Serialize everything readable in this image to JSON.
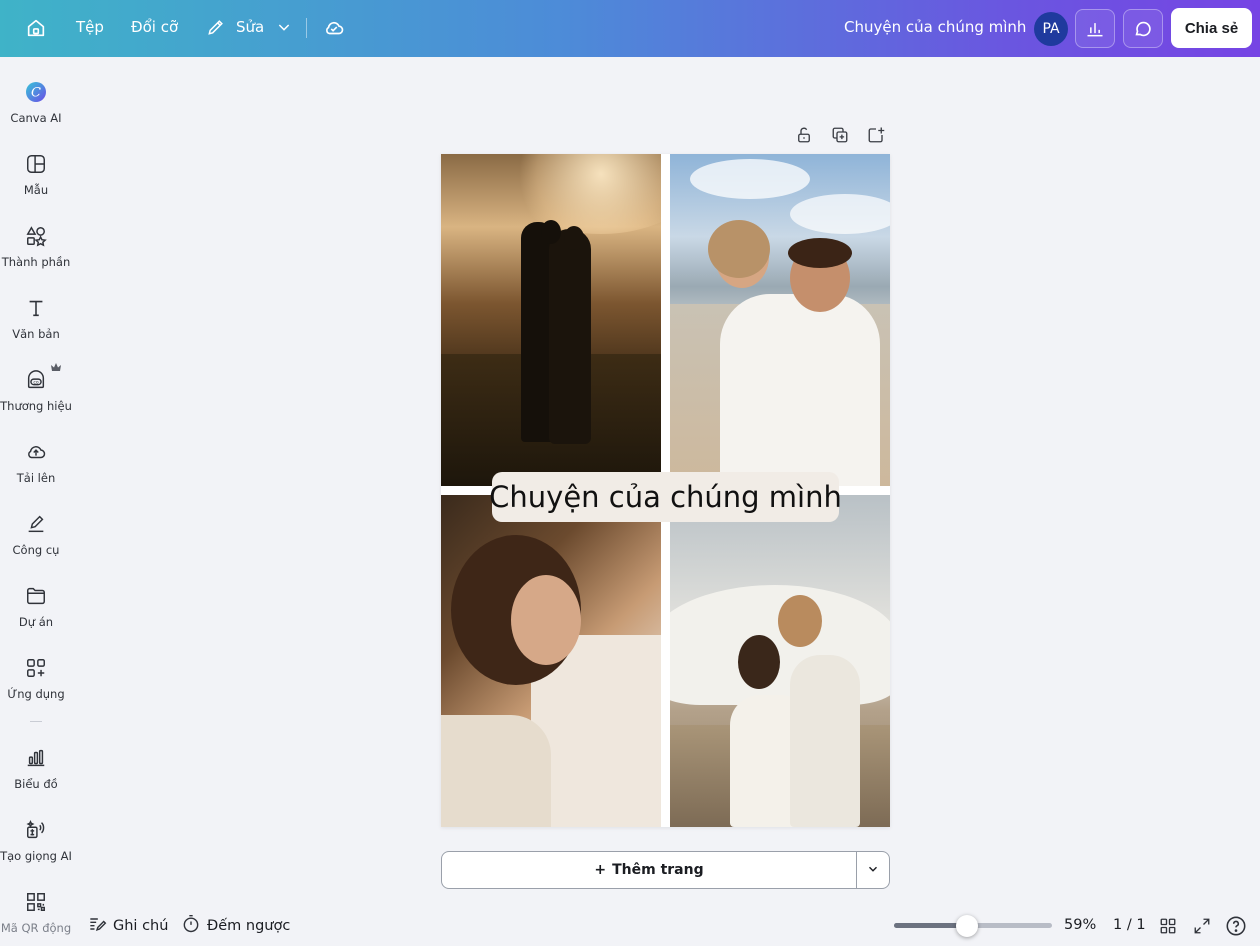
{
  "topbar": {
    "file_label": "Tệp",
    "resize_label": "Đổi cỡ",
    "edit_label": "Sửa",
    "doc_title": "Chuyện của chúng mình",
    "avatar_initials": "PA",
    "share_label": "Chia sẻ",
    "gradient_colors": [
      "#3fb3c8",
      "#7644e4"
    ],
    "icons": [
      "home-icon",
      "pencil-icon",
      "chevron-down-icon",
      "cloud-check-icon",
      "insights-icon",
      "comment-icon"
    ]
  },
  "sidebar": {
    "items": [
      {
        "label": "Canva AI",
        "icon": "canva-ai-icon"
      },
      {
        "label": "Mẫu",
        "icon": "templates-icon"
      },
      {
        "label": "Thành phần",
        "icon": "elements-icon"
      },
      {
        "label": "Văn bản",
        "icon": "text-icon"
      },
      {
        "label": "Thương hiệu",
        "icon": "brand-icon"
      },
      {
        "label": "Tải lên",
        "icon": "upload-icon"
      },
      {
        "label": "Công cụ",
        "icon": "tools-icon"
      },
      {
        "label": "Dự án",
        "icon": "folder-icon"
      },
      {
        "label": "Ứng dụng",
        "icon": "apps-icon"
      },
      {
        "label": "Biểu đồ",
        "icon": "charts-icon"
      },
      {
        "label": "Tạo giọng AI",
        "icon": "ai-voice-icon"
      },
      {
        "label": "Mã QR động",
        "icon": "qr-code-icon"
      }
    ]
  },
  "canvas": {
    "title_text": "Chuyện của chúng mình",
    "page_tools": [
      "lock-icon",
      "duplicate-icon",
      "add-page-icon"
    ]
  },
  "add_page": {
    "label": "Thêm trang",
    "plus": "+"
  },
  "footer": {
    "notes_label": "Ghi chú",
    "timer_label": "Đếm ngược",
    "zoom_value": 59,
    "zoom_label": "59%",
    "page_counter": "1 / 1"
  }
}
